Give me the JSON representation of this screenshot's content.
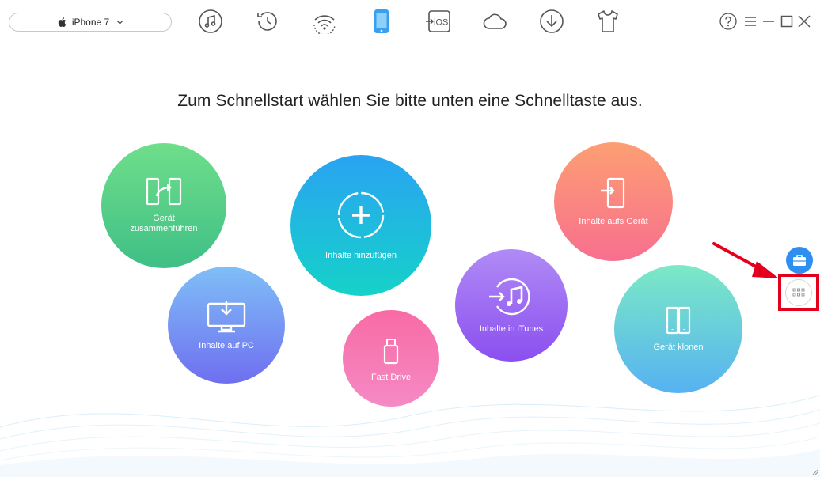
{
  "device_selector": {
    "device_name": "iPhone 7"
  },
  "toolbar": {
    "icons": [
      "itunes-icon",
      "history-icon",
      "wifi-sync-icon",
      "phone-icon",
      "ios-mover-icon",
      "icloud-icon",
      "download-icon",
      "shirt-icon"
    ],
    "active_icon": "phone-icon"
  },
  "window_controls": [
    "help-icon",
    "menu-icon",
    "minimize-icon",
    "maximize-icon",
    "close-icon"
  ],
  "headline": "Zum Schnellstart wählen Sie bitte unten eine Schnelltaste aus.",
  "shortcuts": {
    "merge": "Gerät zusammenführen",
    "add_content": "Inhalte hinzufügen",
    "to_pc": "Inhalte auf PC",
    "fast_drive": "Fast Drive",
    "to_itunes": "Inhalte in iTunes",
    "to_device": "Inhalte aufs Gerät",
    "clone": "Gerät klonen"
  },
  "colors": {
    "accent": "#2f8ff0",
    "highlight": "#e4001d",
    "toolbar_icon": "#555555"
  }
}
